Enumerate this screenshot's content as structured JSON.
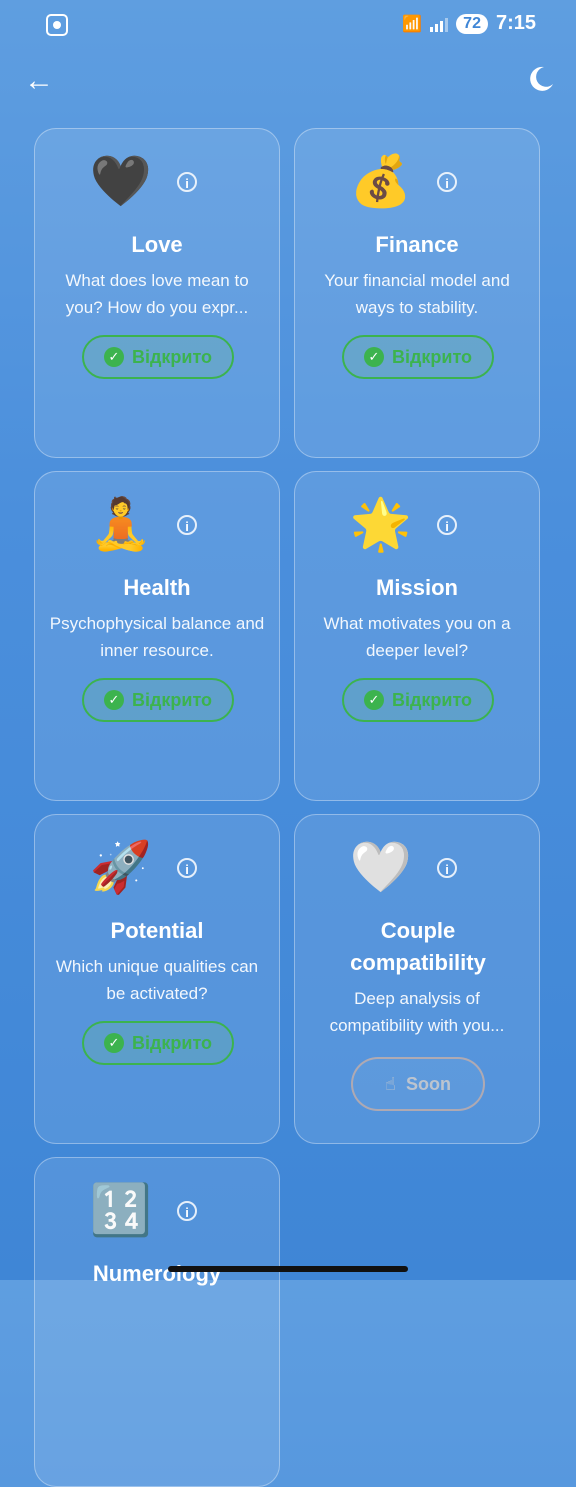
{
  "status_bar": {
    "battery": "72",
    "time": "7:15"
  },
  "cards": [
    {
      "emoji": "🖤",
      "title": "Love",
      "description": "What does love mean to you? How do you expr...",
      "status": "Відкрито"
    },
    {
      "emoji": "💰",
      "title": "Finance",
      "description": "Your financial model and ways to stability.",
      "status": "Відкрито"
    },
    {
      "emoji": "🧘",
      "title": "Health",
      "description": "Psychophysical balance and inner resource.",
      "status": "Відкрито"
    },
    {
      "emoji": "🌟",
      "title": "Mission",
      "description": "What motivates you on a deeper level?",
      "status": "Відкрито"
    },
    {
      "emoji": "🚀",
      "title": "Potential",
      "description": "Which unique qualities can be activated?",
      "status": "Відкрито"
    },
    {
      "emoji": "🤍",
      "title": "Couple compatibility",
      "description": "Deep analysis of compatibility with you...",
      "status": "Soon"
    },
    {
      "emoji": "🔢",
      "title": "Numerology"
    }
  ],
  "colors": {
    "accent_green": "#3cb34e",
    "background_blue": "#4b8fdc"
  },
  "icons": {
    "back": "arrow-left-icon",
    "theme": "moon-icon",
    "info": "info-icon",
    "check": "check-circle-icon",
    "soon": "pointing-hand-icon"
  }
}
